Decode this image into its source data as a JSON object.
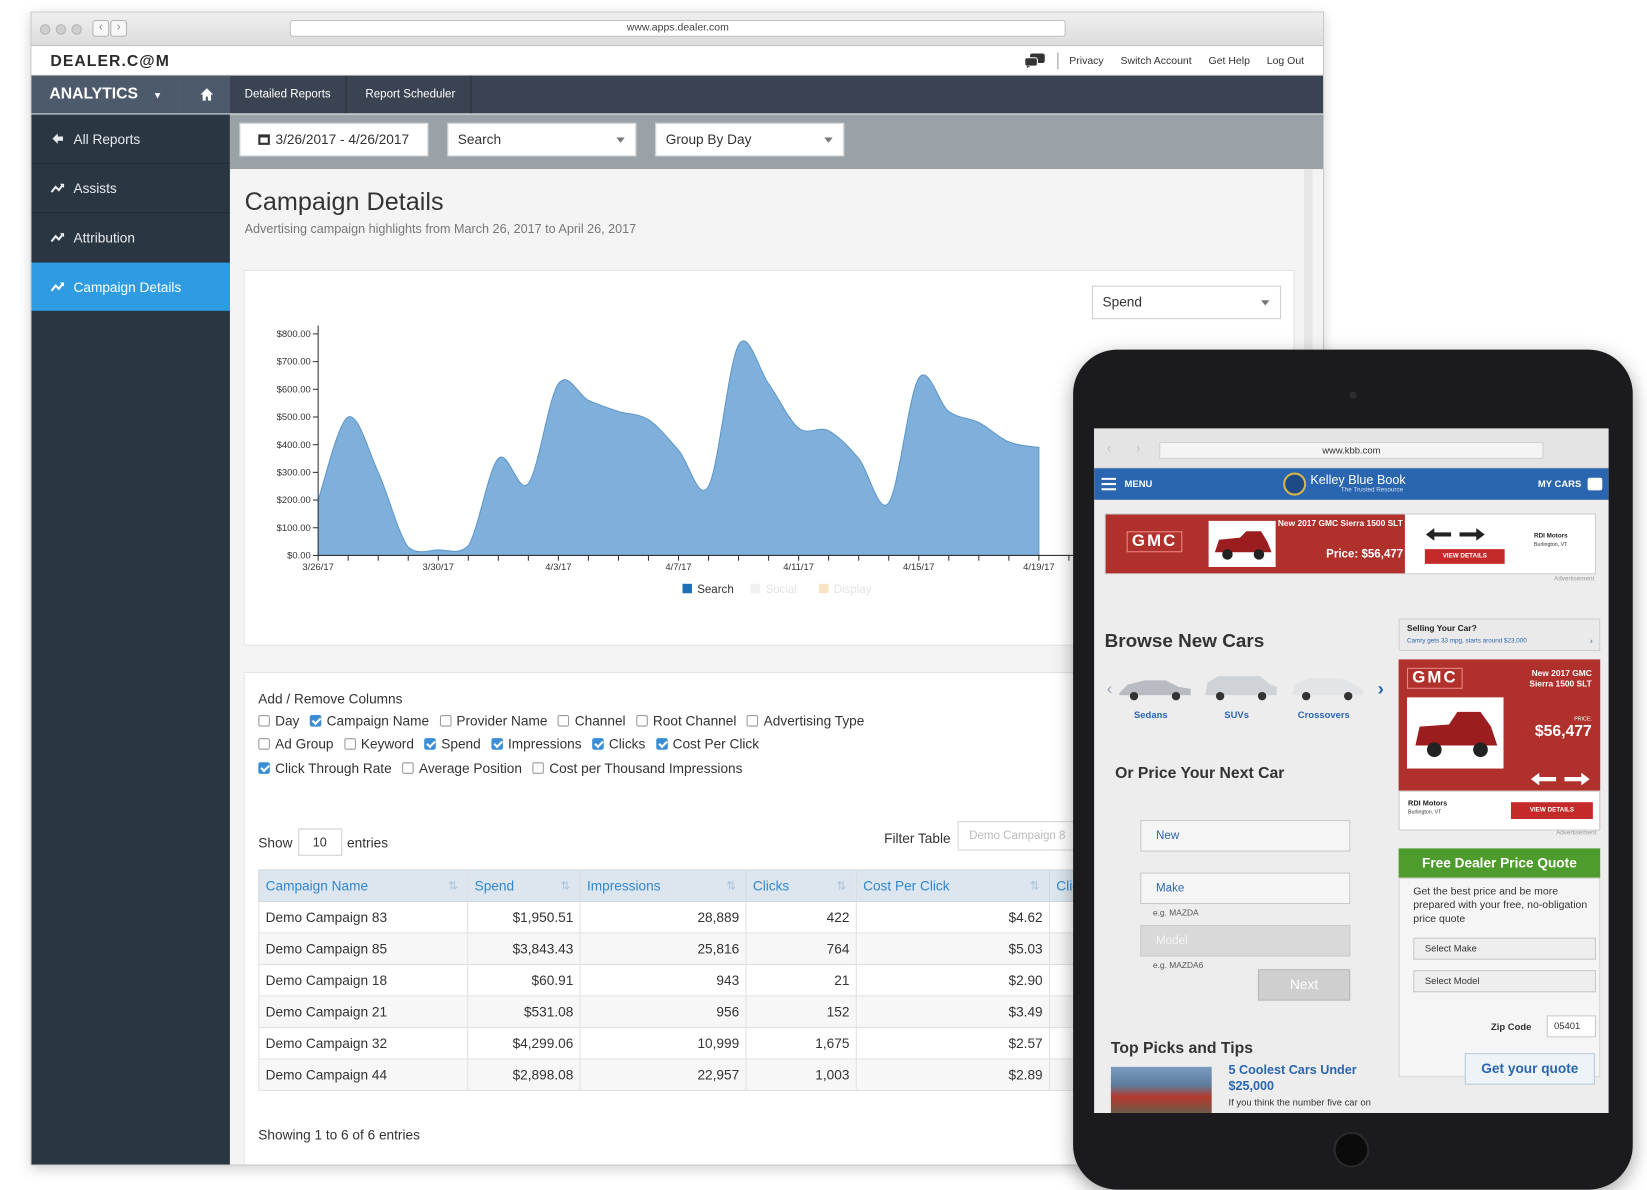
{
  "browser": {
    "url": "www.apps.dealer.com"
  },
  "header": {
    "logo": "DEALER.C@M",
    "links": [
      "Privacy",
      "Switch Account",
      "Get Help",
      "Log Out"
    ]
  },
  "nav": {
    "analytics_label": "ANALYTICS",
    "tabs": [
      "Detailed Reports",
      "Report Scheduler"
    ]
  },
  "sidebar": {
    "items": [
      {
        "label": "All Reports",
        "icon": "back-arrow-icon"
      },
      {
        "label": "Assists",
        "icon": "trend-icon"
      },
      {
        "label": "Attribution",
        "icon": "trend-icon"
      },
      {
        "label": "Campaign Details",
        "icon": "trend-icon",
        "active": true
      }
    ]
  },
  "filters": {
    "date_range": "3/26/2017 - 4/26/2017",
    "channel": "Search",
    "group_by": "Group By Day"
  },
  "page": {
    "title": "Campaign Details",
    "subtitle": "Advertising campaign highlights from March 26, 2017 to April 26, 2017"
  },
  "metric_select": "Spend",
  "chart_data": {
    "type": "area",
    "ylim": [
      0,
      800
    ],
    "yticks": [
      "$0.00",
      "$100.00",
      "$200.00",
      "$300.00",
      "$400.00",
      "$500.00",
      "$600.00",
      "$700.00",
      "$800.00"
    ],
    "xticks": [
      "3/26/17",
      "3/30/17",
      "4/3/17",
      "4/7/17",
      "4/11/17",
      "4/15/17",
      "4/19/17"
    ],
    "x": [
      0,
      1,
      2,
      3,
      4,
      5,
      6,
      7,
      8,
      9,
      10,
      11,
      12,
      13,
      14,
      15,
      16,
      17,
      18,
      19,
      20,
      21,
      22,
      23,
      24
    ],
    "series": [
      {
        "name": "Search",
        "color": "#7fb0db",
        "values": [
          200,
          500,
          300,
          30,
          20,
          35,
          350,
          260,
          620,
          560,
          520,
          490,
          380,
          250,
          760,
          620,
          460,
          450,
          350,
          190,
          640,
          520,
          480,
          410,
          390
        ]
      }
    ],
    "legend": [
      {
        "name": "Search",
        "color": "#1f6fb3"
      },
      {
        "name": "Social",
        "color": "#f0f0f0"
      },
      {
        "name": "Display",
        "color": "#f7e2c4"
      }
    ],
    "legend_position": "bottom",
    "grid": false
  },
  "columns": {
    "title": "Add / Remove Columns",
    "rows": [
      [
        {
          "label": "Day",
          "checked": false
        },
        {
          "label": "Campaign Name",
          "checked": true
        },
        {
          "label": "Provider Name",
          "checked": false
        },
        {
          "label": "Channel",
          "checked": false
        },
        {
          "label": "Root Channel",
          "checked": false
        },
        {
          "label": "Advertising Type",
          "checked": false
        }
      ],
      [
        {
          "label": "Ad Group",
          "checked": false
        },
        {
          "label": "Keyword",
          "checked": false
        },
        {
          "label": "Spend",
          "checked": true
        },
        {
          "label": "Impressions",
          "checked": true
        },
        {
          "label": "Clicks",
          "checked": true
        },
        {
          "label": "Cost Per Click",
          "checked": true
        }
      ],
      [
        {
          "label": "Click Through Rate",
          "checked": true
        },
        {
          "label": "Average Position",
          "checked": false
        },
        {
          "label": "Cost per Thousand Impressions",
          "checked": false
        }
      ]
    ]
  },
  "table": {
    "show_label": "Show",
    "entries_value": "10",
    "entries_label": "entries",
    "filter_label": "Filter Table",
    "filter_placeholder": "Demo Campaign 8",
    "headers": [
      "Campaign Name",
      "Spend",
      "Impressions",
      "Clicks",
      "Cost Per Click",
      "Clic"
    ],
    "rows": [
      [
        "Demo Campaign 83",
        "$1,950.51",
        "28,889",
        "422",
        "$4.62"
      ],
      [
        "Demo Campaign 85",
        "$3,843.43",
        "25,816",
        "764",
        "$5.03"
      ],
      [
        "Demo Campaign 18",
        "$60.91",
        "943",
        "21",
        "$2.90"
      ],
      [
        "Demo Campaign 21",
        "$531.08",
        "956",
        "152",
        "$3.49"
      ],
      [
        "Demo Campaign 32",
        "$4,299.06",
        "10,999",
        "1,675",
        "$2.57"
      ],
      [
        "Demo Campaign 44",
        "$2,898.08",
        "22,957",
        "1,003",
        "$2.89"
      ]
    ],
    "footer": "Showing 1 to 6 of 6 entries"
  },
  "tablet": {
    "url": "www.kbb.com",
    "menu_label": "MENU",
    "brand": "Kelley Blue Book",
    "brand_tagline": "The Trusted Resource",
    "my_cars": "MY CARS",
    "ad1": {
      "brand": "GMC",
      "headline": "New 2017 GMC Sierra 1500 SLT",
      "price": "Price: $56,477",
      "cta": "VIEW DETAILS",
      "dealer": "RDI Motors",
      "dealer_city": "Burlington, VT",
      "tag": "Advertisement"
    },
    "browse_title": "Browse New Cars",
    "car_types": [
      "Sedans",
      "SUVs",
      "Crossovers"
    ],
    "selling": {
      "title": "Selling Your Car?",
      "subtitle": "Camry gets 33 mpg, starts around $23,000"
    },
    "ad2": {
      "brand": "GMC",
      "headline": "New 2017 GMC Sierra 1500 SLT",
      "price_label": "PRICE:",
      "price": "$56,477",
      "dealer": "RDI Motors",
      "dealer_city": "Burlington, VT",
      "cta": "VIEW DETAILS",
      "tag": "Advertisement"
    },
    "price_title": "Or Price Your Next Car",
    "new_field": "New",
    "make_field": "Make",
    "make_example": "e.g. MAZDA",
    "model_field": "Model",
    "model_example": "e.g. MAZDA6",
    "next_label": "Next",
    "quote": {
      "title": "Free Dealer Price Quote",
      "text": "Get the best price and be more prepared with your free, no-obligation price quote",
      "make": "Select Make",
      "model": "Select Model",
      "zip_label": "Zip Code",
      "zip_value": "05401",
      "button": "Get your quote"
    },
    "top_picks": "Top Picks and Tips",
    "pick_title": "5 Coolest Cars Under $25,000",
    "pick_desc": "If you think the number five car on"
  }
}
